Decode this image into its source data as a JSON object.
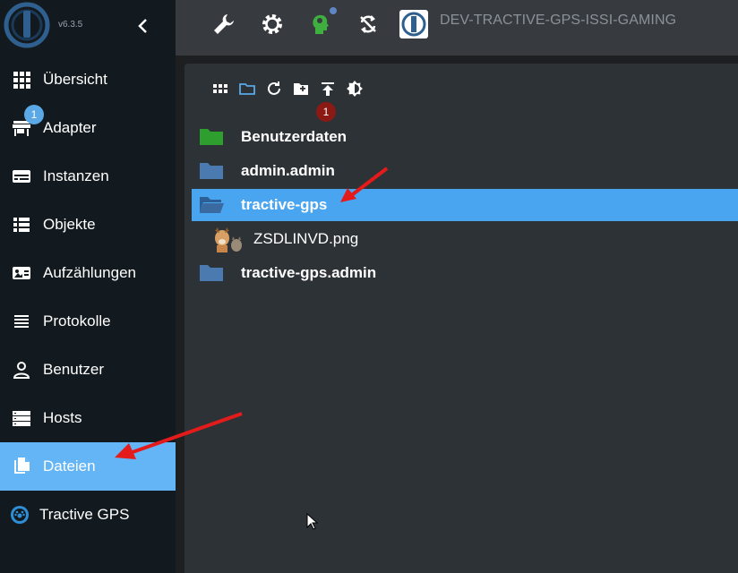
{
  "app": {
    "version": "v6.3.5",
    "instance_title": "DEV-TRACTIVE-GPS-ISSI-GAMING"
  },
  "sidebar": {
    "adapter_badge": "1",
    "items": [
      {
        "label": "Übersicht",
        "icon": "grid-icon"
      },
      {
        "label": "Adapter",
        "icon": "store-icon"
      },
      {
        "label": "Instanzen",
        "icon": "instances-icon"
      },
      {
        "label": "Objekte",
        "icon": "list-icon"
      },
      {
        "label": "Aufzählungen",
        "icon": "enum-icon"
      },
      {
        "label": "Protokolle",
        "icon": "log-icon"
      },
      {
        "label": "Benutzer",
        "icon": "user-icon"
      },
      {
        "label": "Hosts",
        "icon": "hosts-icon"
      },
      {
        "label": "Dateien",
        "icon": "files-icon",
        "active": true
      },
      {
        "label": "Tractive GPS",
        "icon": "tractive-icon"
      }
    ]
  },
  "toolbar": {
    "upload_badge": "1",
    "icons": [
      "view-grid-icon",
      "folder-view-icon",
      "refresh-icon",
      "add-folder-icon",
      "upload-icon",
      "brightness-icon"
    ]
  },
  "files": [
    {
      "name": "Benutzerdaten",
      "type": "folder",
      "color": "#2e9e2e"
    },
    {
      "name": "admin.admin",
      "type": "folder",
      "color": "#4a7ab0"
    },
    {
      "name": "tractive-gps",
      "type": "folder-open",
      "color": "#3a6aa0",
      "selected": true
    },
    {
      "name": "ZSDLINVD.png",
      "type": "image"
    },
    {
      "name": "tractive-gps.admin",
      "type": "folder",
      "color": "#4a7ab0"
    }
  ],
  "colors": {
    "accent": "#64b5f6",
    "selected_row": "#4aa5f0",
    "annotation_arrow": "#e31b1b"
  }
}
